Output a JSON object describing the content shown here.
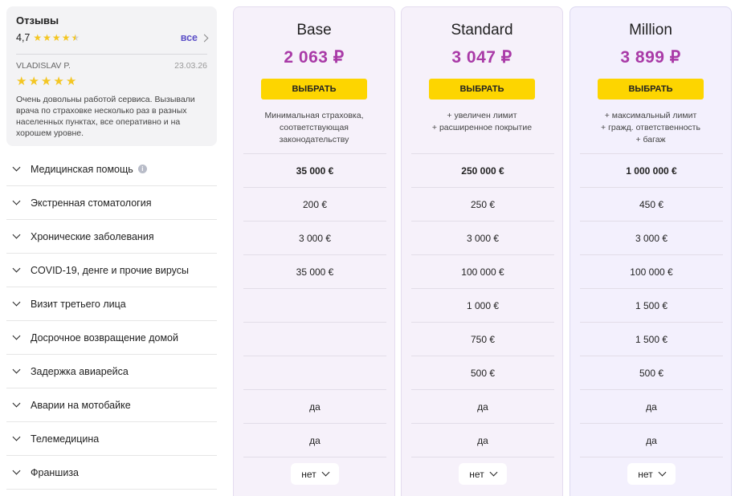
{
  "reviews": {
    "title": "Отзывы",
    "score": "4,7",
    "all_label": "все",
    "review": {
      "author": "VLADISLAV P.",
      "date": "23.03.26",
      "stars": 5,
      "text": "Очень довольны работой сервиса. Вызывали врача по страховке несколько раз в разных населенных пунктах, все оперативно и на хорошем уровне."
    }
  },
  "features": [
    {
      "label": "Медицинская помощь",
      "info": true
    },
    {
      "label": "Экстренная стоматология"
    },
    {
      "label": "Хронические заболевания"
    },
    {
      "label": "COVID-19, денге и прочие вирусы"
    },
    {
      "label": "Визит третьего лица"
    },
    {
      "label": "Досрочное возвращение домой"
    },
    {
      "label": "Задержка авиарейса"
    },
    {
      "label": "Аварии на мотобайке"
    },
    {
      "label": "Телемедицина"
    },
    {
      "label": "Франшиза"
    }
  ],
  "plans": [
    {
      "name": "Base",
      "price": "2 063 ₽",
      "button": "ВЫБРАТЬ",
      "desc": [
        "Минимальная страховка,",
        "соответствующая",
        "законодательству"
      ],
      "cells": [
        "35 000 €",
        "200 €",
        "3 000 €",
        "35 000 €",
        "",
        "",
        "",
        "да",
        "да"
      ],
      "franchise": "нет"
    },
    {
      "name": "Standard",
      "price": "3 047 ₽",
      "button": "ВЫБРАТЬ",
      "desc": [
        "+ увеличен лимит",
        "+ расширенное покрытие"
      ],
      "cells": [
        "250 000 €",
        "250 €",
        "3 000 €",
        "100 000 €",
        "1 000 €",
        "750 €",
        "500 €",
        "да",
        "да"
      ],
      "franchise": "нет"
    },
    {
      "name": "Million",
      "price": "3 899 ₽",
      "button": "ВЫБРАТЬ",
      "desc": [
        "+ максимальный лимит",
        "+ гражд. ответственность",
        "+ багаж"
      ],
      "cells": [
        "1 000 000 €",
        "450 €",
        "3 000 €",
        "100 000 €",
        "1 500 €",
        "1 500 €",
        "500 €",
        "да",
        "да"
      ],
      "franchise": "нет"
    }
  ],
  "colors": {
    "accent_price": "#a93aa7",
    "button": "#fdd500",
    "link": "#5b4fc7",
    "star": "#f3c623"
  }
}
